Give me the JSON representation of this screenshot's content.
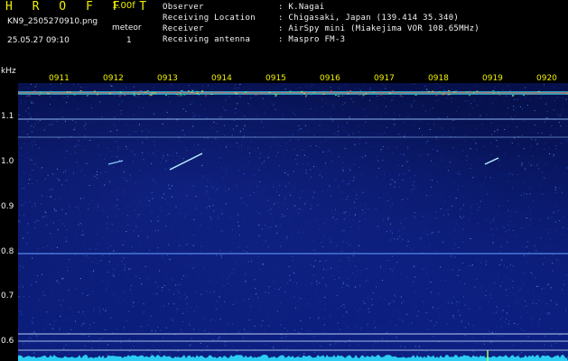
{
  "header": {
    "brand": "H R O F F T",
    "version": "1.00f",
    "filename": "KN9_2505270910.png",
    "meteor_label": "meteor",
    "meteor_count": "1",
    "datetime": "25.05.27 09:10",
    "info": [
      {
        "label": "Observer",
        "value": ": K.Nagai"
      },
      {
        "label": "Receiving Location",
        "value": ": Chigasaki, Japan (139.414 35.340)"
      },
      {
        "label": "Receiver",
        "value": ": AirSpy mini (Miakejima VOR 108.65MHz)"
      },
      {
        "label": "Receiving antenna",
        "value": ": Maspro FM-3"
      }
    ]
  },
  "axis": {
    "unit": "kHz",
    "y_ticks": [
      "1.1",
      "1.0",
      "0.9",
      "0.8",
      "0.7",
      "0.6"
    ],
    "time_ticks": [
      "0911",
      "0912",
      "0913",
      "0914",
      "0915",
      "0916",
      "0917",
      "0918",
      "0919",
      "0920"
    ]
  },
  "colors": {
    "brand": "#f0f000",
    "header_text": "#f2f2f2",
    "filename_text": "#38e838",
    "background": "#0a1a70",
    "trace": "#30e0ff"
  }
}
